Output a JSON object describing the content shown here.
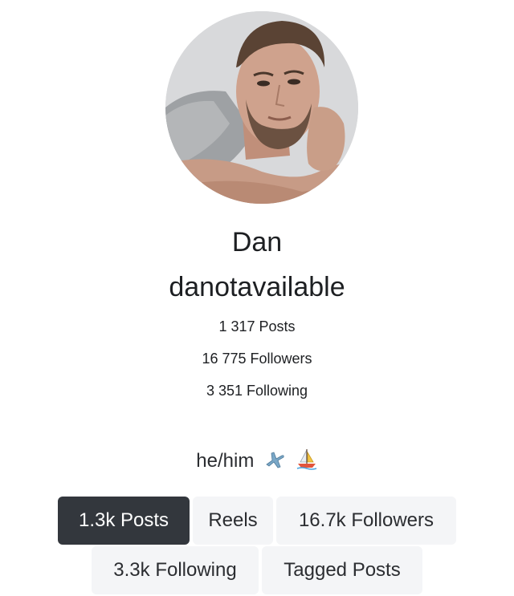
{
  "profile": {
    "display_name": "Dan",
    "username": "danotavailable",
    "avatar_icon": "profile-photo"
  },
  "stats": {
    "posts": "1 317 Posts",
    "followers": "16 775 Followers",
    "following": "3 351 Following"
  },
  "bio": {
    "text": "he/him",
    "emojis": [
      "airplane-icon",
      "sailboat-icon"
    ]
  },
  "tabs": [
    {
      "label": "1.3k Posts",
      "active": true
    },
    {
      "label": "Reels",
      "active": false
    },
    {
      "label": "16.7k Followers",
      "active": false
    },
    {
      "label": "3.3k Following",
      "active": false
    },
    {
      "label": "Tagged Posts",
      "active": false
    }
  ],
  "colors": {
    "active_tab_bg": "#33373d",
    "tab_bg": "#f4f5f7",
    "text": "#1d1f22"
  }
}
